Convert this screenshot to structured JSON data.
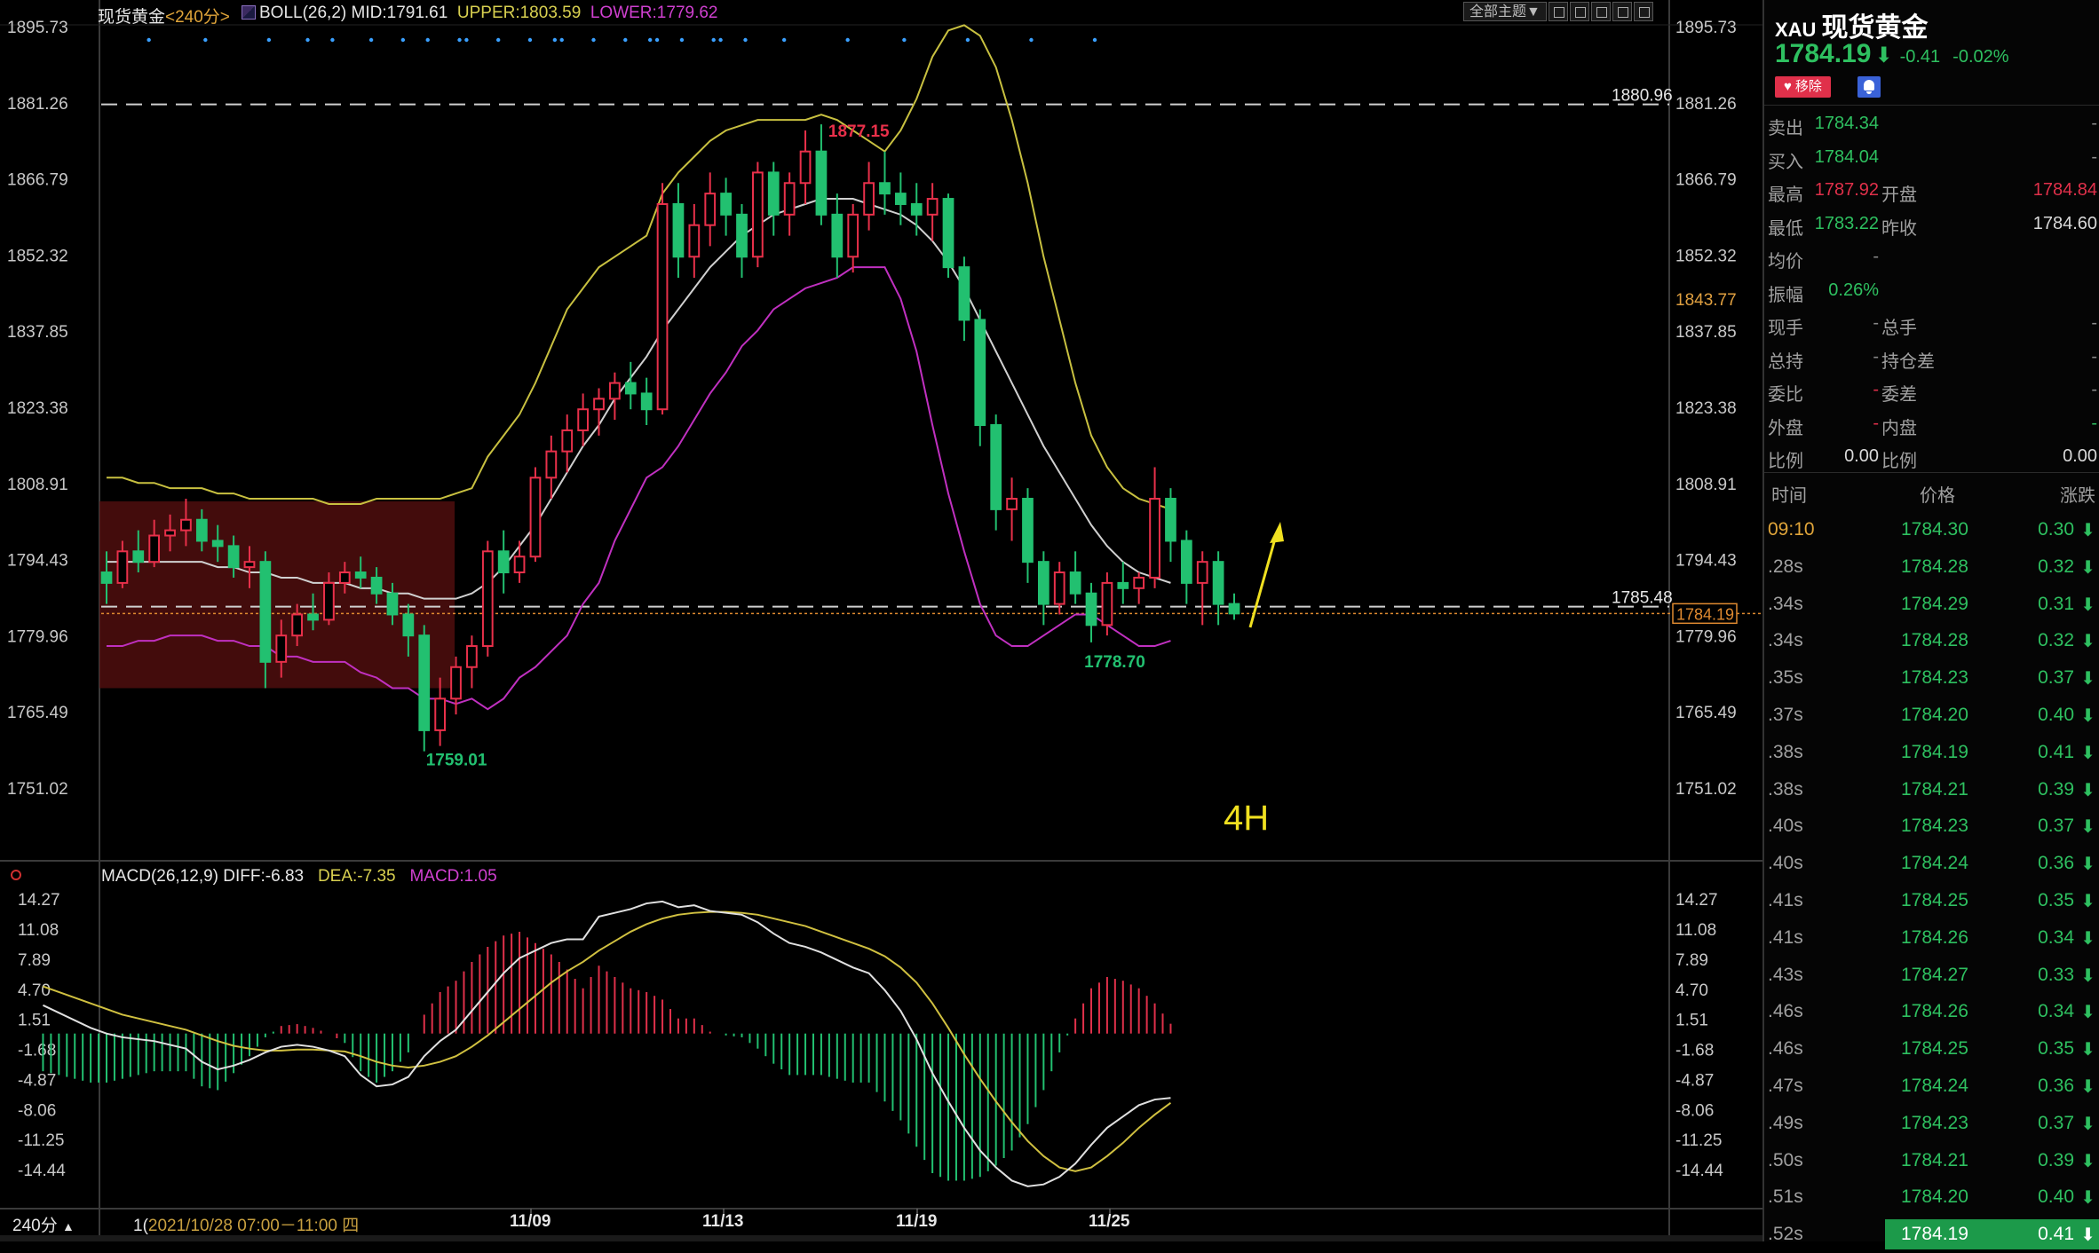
{
  "main_header": {
    "symbol_name": "现货黄金",
    "period": "<240分>",
    "indicator": "BOLL(26,2)",
    "mid": "MID:1791.61",
    "upper": "UPPER:1803.59",
    "lower": "LOWER:1779.62"
  },
  "toolbar": {
    "theme_label": "全部主题▼"
  },
  "macd_header": {
    "label": "MACD(26,12,9)",
    "diff": "DIFF:-6.83",
    "dea": "DEA:-7.35",
    "macd": "MACD:1.05"
  },
  "chart_overlay_text": {
    "timeframe": "4H"
  },
  "bottom_bar": {
    "period": "240分",
    "date_prefix": "1(",
    "cursor_date": "2021/10/28 07:00－11:00 四"
  },
  "chart_data": [
    {
      "type": "candlestick",
      "price_axis_ticks": [
        "1895.73",
        "1881.26",
        "1866.79",
        "1852.32",
        "1837.85",
        "1823.38",
        "1808.91",
        "1794.43",
        "1779.96",
        "1765.49",
        "1751.02"
      ],
      "ylim": [
        1751.02,
        1895.73
      ],
      "x_ticks": [
        "11/09",
        "11/13",
        "11/19",
        "11/25"
      ],
      "price_line_labels": {
        "high_line": "1880.96",
        "mid_line": "1785.48",
        "orange_mark": "1843.77",
        "current": "1784.19"
      },
      "annotations": {
        "peak": "1877.15",
        "low_left": "1759.01",
        "low_right": "1778.70"
      },
      "colors": {
        "up": "#e8304a",
        "down": "#22c070",
        "mid": "#d0d0d0",
        "upper": "#c8c040",
        "lower": "#c030c0",
        "annotation_arrow": "#f0e020"
      },
      "candles": [
        [
          1792.0,
          1796.0,
          1786.0,
          1790.0
        ],
        [
          1790.0,
          1798.0,
          1789.0,
          1796.0
        ],
        [
          1796.0,
          1800.0,
          1792.0,
          1794.0
        ],
        [
          1794.0,
          1802.0,
          1793.0,
          1799.0
        ],
        [
          1799.0,
          1803.0,
          1796.0,
          1800.0
        ],
        [
          1800.0,
          1806.0,
          1797.0,
          1802.0
        ],
        [
          1802.0,
          1804.0,
          1796.0,
          1798.0
        ],
        [
          1798.0,
          1801.0,
          1794.0,
          1797.0
        ],
        [
          1797.0,
          1799.0,
          1791.0,
          1793.0
        ],
        [
          1793.0,
          1797.0,
          1789.0,
          1794.0
        ],
        [
          1794.0,
          1796.0,
          1770.0,
          1775.0
        ],
        [
          1775.0,
          1783.0,
          1772.0,
          1780.0
        ],
        [
          1780.0,
          1786.0,
          1778.0,
          1784.0
        ],
        [
          1784.0,
          1788.0,
          1781.0,
          1783.0
        ],
        [
          1783.0,
          1792.0,
          1782.0,
          1790.0
        ],
        [
          1790.0,
          1794.0,
          1788.0,
          1792.0
        ],
        [
          1792.0,
          1795.0,
          1789.0,
          1791.0
        ],
        [
          1791.0,
          1793.0,
          1786.0,
          1788.0
        ],
        [
          1788.0,
          1790.0,
          1782.0,
          1784.0
        ],
        [
          1784.0,
          1786.0,
          1776.0,
          1780.0
        ],
        [
          1780.0,
          1782.0,
          1758.0,
          1762.0
        ],
        [
          1762.0,
          1772.0,
          1759.0,
          1768.0
        ],
        [
          1768.0,
          1776.0,
          1765.0,
          1774.0
        ],
        [
          1774.0,
          1780.0,
          1770.0,
          1778.0
        ],
        [
          1778.0,
          1798.0,
          1776.0,
          1796.0
        ],
        [
          1796.0,
          1800.0,
          1788.0,
          1792.0
        ],
        [
          1792.0,
          1798.0,
          1790.0,
          1795.0
        ],
        [
          1795.0,
          1812.0,
          1794.0,
          1810.0
        ],
        [
          1810.0,
          1818.0,
          1806.0,
          1815.0
        ],
        [
          1815.0,
          1822.0,
          1811.0,
          1819.0
        ],
        [
          1819.0,
          1826.0,
          1816.0,
          1823.0
        ],
        [
          1823.0,
          1827.0,
          1818.0,
          1825.0
        ],
        [
          1825.0,
          1830.0,
          1821.0,
          1828.0
        ],
        [
          1828.0,
          1832.0,
          1823.0,
          1826.0
        ],
        [
          1826.0,
          1829.0,
          1820.0,
          1823.0
        ],
        [
          1823.0,
          1866.0,
          1822.0,
          1862.0
        ],
        [
          1862.0,
          1866.0,
          1848.0,
          1852.0
        ],
        [
          1852.0,
          1862.0,
          1848.0,
          1858.0
        ],
        [
          1858.0,
          1868.0,
          1854.0,
          1864.0
        ],
        [
          1864.0,
          1867.0,
          1856.0,
          1860.0
        ],
        [
          1860.0,
          1862.0,
          1848.0,
          1852.0
        ],
        [
          1852.0,
          1870.0,
          1850.0,
          1868.0
        ],
        [
          1868.0,
          1870.0,
          1856.0,
          1860.0
        ],
        [
          1860.0,
          1868.0,
          1856.0,
          1866.0
        ],
        [
          1866.0,
          1876.0,
          1862.0,
          1872.0
        ],
        [
          1872.0,
          1877.15,
          1858.0,
          1860.0
        ],
        [
          1860.0,
          1864.0,
          1848.0,
          1852.0
        ],
        [
          1852.0,
          1862.0,
          1849.0,
          1860.0
        ],
        [
          1860.0,
          1870.0,
          1857.0,
          1866.0
        ],
        [
          1866.0,
          1872.0,
          1860.0,
          1864.0
        ],
        [
          1864.0,
          1868.0,
          1858.0,
          1862.0
        ],
        [
          1862.0,
          1866.0,
          1856.0,
          1860.0
        ],
        [
          1860.0,
          1866.0,
          1855.0,
          1863.0
        ],
        [
          1863.0,
          1864.0,
          1848.0,
          1850.0
        ],
        [
          1850.0,
          1852.0,
          1836.0,
          1840.0
        ],
        [
          1840.0,
          1842.0,
          1816.0,
          1820.0
        ],
        [
          1820.0,
          1822.0,
          1800.0,
          1804.0
        ],
        [
          1804.0,
          1810.0,
          1798.0,
          1806.0
        ],
        [
          1806.0,
          1808.0,
          1790.0,
          1794.0
        ],
        [
          1794.0,
          1796.0,
          1782.0,
          1786.0
        ],
        [
          1786.0,
          1794.0,
          1784.0,
          1792.0
        ],
        [
          1792.0,
          1796.0,
          1786.0,
          1788.0
        ],
        [
          1788.0,
          1790.0,
          1778.7,
          1782.0
        ],
        [
          1782.0,
          1792.0,
          1780.0,
          1790.0
        ],
        [
          1790.0,
          1794.0,
          1786.0,
          1789.0
        ],
        [
          1789.0,
          1792.0,
          1786.0,
          1791.0
        ],
        [
          1791.0,
          1812.0,
          1789.0,
          1806.0
        ],
        [
          1806.0,
          1808.0,
          1794.0,
          1798.0
        ],
        [
          1798.0,
          1800.0,
          1786.0,
          1790.0
        ],
        [
          1790.0,
          1796.0,
          1782.0,
          1794.0
        ],
        [
          1794.0,
          1796.0,
          1782.0,
          1786.0
        ],
        [
          1786.0,
          1788.0,
          1783.0,
          1784.19
        ]
      ],
      "boll_upper": [
        1810,
        1810,
        1809,
        1809,
        1808,
        1808,
        1808,
        1807,
        1807,
        1806,
        1806,
        1806,
        1806,
        1806,
        1805,
        1805,
        1805,
        1806,
        1806,
        1806,
        1806,
        1806,
        1807,
        1808,
        1814,
        1818,
        1822,
        1828,
        1835,
        1842,
        1846,
        1850,
        1852,
        1854,
        1856,
        1864,
        1868,
        1871,
        1874,
        1876,
        1877,
        1878,
        1878,
        1878,
        1878,
        1879,
        1878,
        1876,
        1874,
        1872,
        1876,
        1882,
        1890,
        1895,
        1896,
        1894,
        1888,
        1878,
        1866,
        1852,
        1840,
        1828,
        1818,
        1812,
        1808,
        1806,
        1805,
        1804
      ],
      "boll_mid": [
        1794,
        1794,
        1794,
        1794,
        1794,
        1794,
        1794,
        1793,
        1793,
        1792,
        1792,
        1791,
        1791,
        1790,
        1790,
        1790,
        1789,
        1789,
        1788,
        1788,
        1787,
        1787,
        1787,
        1788,
        1790,
        1793,
        1797,
        1801,
        1806,
        1811,
        1816,
        1820,
        1825,
        1829,
        1833,
        1838,
        1842,
        1846,
        1850,
        1853,
        1856,
        1858,
        1860,
        1861,
        1862,
        1863,
        1863,
        1863,
        1862,
        1861,
        1860,
        1858,
        1855,
        1851,
        1846,
        1840,
        1834,
        1828,
        1822,
        1816,
        1811,
        1806,
        1801,
        1797,
        1794,
        1792,
        1791,
        1790
      ],
      "boll_lower": [
        1778,
        1778,
        1779,
        1779,
        1780,
        1780,
        1780,
        1779,
        1779,
        1778,
        1778,
        1776,
        1776,
        1775,
        1775,
        1775,
        1773,
        1772,
        1770,
        1770,
        1768,
        1768,
        1767,
        1768,
        1766,
        1768,
        1772,
        1774,
        1777,
        1780,
        1786,
        1790,
        1798,
        1804,
        1810,
        1812,
        1816,
        1821,
        1826,
        1830,
        1835,
        1838,
        1842,
        1844,
        1846,
        1847,
        1848,
        1850,
        1850,
        1850,
        1844,
        1834,
        1820,
        1807,
        1796,
        1786,
        1780,
        1778,
        1778,
        1780,
        1782,
        1784,
        1784,
        1782,
        1780,
        1778,
        1778,
        1779
      ],
      "boll_start_index": 0
    },
    {
      "type": "macd",
      "axis_ticks": [
        "14.27",
        "11.08",
        "7.89",
        "4.70",
        "1.51",
        "-1.68",
        "-4.87",
        "-8.06",
        "-11.25",
        "-14.44"
      ],
      "ylim": [
        -16.5,
        15.5
      ],
      "colors": {
        "diff": "#e0e0e0",
        "dea": "#d0c040",
        "pos": "#e0304a",
        "neg": "#22c070"
      },
      "diff": [
        3.0,
        2.2,
        1.4,
        0.6,
        0.0,
        -0.4,
        -0.6,
        -0.8,
        -1.2,
        -1.6,
        -3.0,
        -3.8,
        -3.4,
        -2.8,
        -2.0,
        -1.4,
        -1.2,
        -1.4,
        -1.8,
        -2.4,
        -4.4,
        -5.6,
        -5.4,
        -4.6,
        -2.4,
        -0.8,
        0.4,
        2.4,
        4.4,
        6.4,
        8.0,
        8.8,
        9.6,
        10.0,
        10.0,
        12.4,
        12.8,
        13.2,
        13.8,
        14.0,
        13.4,
        13.6,
        13.0,
        12.8,
        12.6,
        11.8,
        10.6,
        9.6,
        9.2,
        8.6,
        7.8,
        7.0,
        6.4,
        4.6,
        2.4,
        -0.6,
        -4.2,
        -7.2,
        -10.0,
        -12.4,
        -14.2,
        -15.6,
        -16.2,
        -16.0,
        -15.2,
        -13.8,
        -11.8,
        -10.0,
        -8.8,
        -7.6,
        -7.0,
        -6.83
      ],
      "dea": [
        5.0,
        4.4,
        3.8,
        3.2,
        2.6,
        2.0,
        1.6,
        1.2,
        0.8,
        0.4,
        -0.2,
        -0.8,
        -1.3,
        -1.6,
        -1.8,
        -1.8,
        -1.7,
        -1.7,
        -1.8,
        -1.9,
        -2.4,
        -3.0,
        -3.4,
        -3.6,
        -3.4,
        -3.0,
        -2.4,
        -1.4,
        -0.2,
        1.2,
        2.6,
        4.0,
        5.4,
        6.6,
        7.6,
        8.8,
        9.8,
        10.8,
        11.6,
        12.2,
        12.6,
        12.8,
        12.9,
        12.9,
        12.8,
        12.6,
        12.2,
        11.8,
        11.4,
        10.8,
        10.2,
        9.6,
        9.0,
        8.2,
        7.0,
        5.4,
        3.2,
        0.6,
        -2.2,
        -4.8,
        -7.2,
        -9.4,
        -11.4,
        -13.0,
        -14.2,
        -14.6,
        -14.2,
        -13.0,
        -11.6,
        -10.0,
        -8.6,
        -7.35
      ],
      "start_index": -4
    }
  ],
  "quote_panel": {
    "symbol": "XAU",
    "name": "现货黄金",
    "price": "1784.19",
    "change": "-0.41",
    "change_pct": "-0.02%",
    "remove_label": "移除",
    "rows": [
      {
        "l1": "卖出",
        "v1": "1784.34",
        "c1": "g",
        "l2": "",
        "v2": "-",
        "c2": "dim"
      },
      {
        "l1": "买入",
        "v1": "1784.04",
        "c1": "g",
        "l2": "",
        "v2": "-",
        "c2": "dim"
      },
      {
        "l1": "最高",
        "v1": "1787.92",
        "c1": "r",
        "l2": "开盘",
        "v2": "1784.84",
        "c2": "r"
      },
      {
        "l1": "最低",
        "v1": "1783.22",
        "c1": "g",
        "l2": "昨收",
        "v2": "1784.60",
        "c2": "w"
      },
      {
        "l1": "均价",
        "v1": "-",
        "c1": "dim",
        "l2": "",
        "v2": "",
        "c2": "dim"
      },
      {
        "l1": "振幅",
        "v1": "0.26%",
        "c1": "g",
        "l2": "",
        "v2": "",
        "c2": "dim"
      },
      {
        "l1": "现手",
        "v1": "-",
        "c1": "dim",
        "l2": "总手",
        "v2": "-",
        "c2": "dim"
      },
      {
        "l1": "总持",
        "v1": "-",
        "c1": "dim",
        "l2": "持仓差",
        "v2": "-",
        "c2": "dim"
      },
      {
        "l1": "委比",
        "v1": "-",
        "c1": "r",
        "l2": "委差",
        "v2": "-",
        "c2": "dim"
      },
      {
        "l1": "外盘",
        "v1": "-",
        "c1": "r",
        "l2": "内盘",
        "v2": "-",
        "c2": "g"
      },
      {
        "l1": "比例",
        "v1": "0.00",
        "c1": "w",
        "l2": "比例",
        "v2": "0.00",
        "c2": "w"
      }
    ],
    "ticks_header": {
      "time": "时间",
      "price": "价格",
      "change": "涨跌"
    },
    "ticks": [
      {
        "t": "09:10",
        "p": "1784.30",
        "c": "0.30"
      },
      {
        "t": ".28s",
        "p": "1784.28",
        "c": "0.32"
      },
      {
        "t": ".34s",
        "p": "1784.29",
        "c": "0.31"
      },
      {
        "t": ".34s",
        "p": "1784.28",
        "c": "0.32"
      },
      {
        "t": ".35s",
        "p": "1784.23",
        "c": "0.37"
      },
      {
        "t": ".37s",
        "p": "1784.20",
        "c": "0.40"
      },
      {
        "t": ".38s",
        "p": "1784.19",
        "c": "0.41"
      },
      {
        "t": ".38s",
        "p": "1784.21",
        "c": "0.39"
      },
      {
        "t": ".40s",
        "p": "1784.23",
        "c": "0.37"
      },
      {
        "t": ".40s",
        "p": "1784.24",
        "c": "0.36"
      },
      {
        "t": ".41s",
        "p": "1784.25",
        "c": "0.35"
      },
      {
        "t": ".41s",
        "p": "1784.26",
        "c": "0.34"
      },
      {
        "t": ".43s",
        "p": "1784.27",
        "c": "0.33"
      },
      {
        "t": ".46s",
        "p": "1784.26",
        "c": "0.34"
      },
      {
        "t": ".46s",
        "p": "1784.25",
        "c": "0.35"
      },
      {
        "t": ".47s",
        "p": "1784.24",
        "c": "0.36"
      },
      {
        "t": ".49s",
        "p": "1784.23",
        "c": "0.37"
      },
      {
        "t": ".50s",
        "p": "1784.21",
        "c": "0.39"
      },
      {
        "t": ".51s",
        "p": "1784.20",
        "c": "0.40"
      },
      {
        "t": ".52s",
        "p": "1784.19",
        "c": "0.41"
      }
    ]
  }
}
